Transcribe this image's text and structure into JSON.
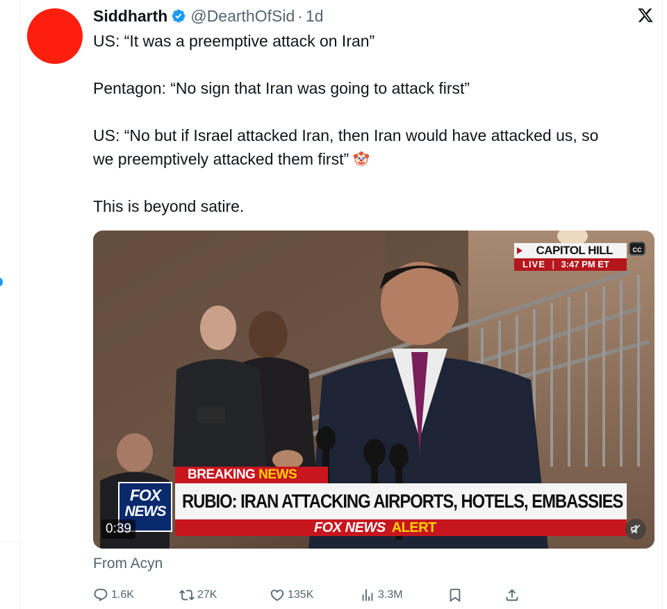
{
  "tweet": {
    "author_name": "Siddharth",
    "handle": "@DearthOfSid",
    "separator": "·",
    "time": "1d",
    "lines": {
      "l1": "US: “It was a preemptive attack on Iran”",
      "l2": "Pentagon: “No sign that Iran was going to attack first”",
      "l3": "US: “No but if Israel attacked Iran, then Iran would have attacked us, so",
      "l4": "we preemptively attacked them first”",
      "l5": "This is beyond satire."
    }
  },
  "video": {
    "location": "CAPITOL HILL",
    "live": "LIVE",
    "live_sep": "|",
    "live_time": "3:47 PM ET",
    "cc": "CC",
    "breaking": "BREAKING",
    "breaking_news": "NEWS",
    "logo_fox": "FOX",
    "logo_news": "NEWS",
    "headline": "RUBIO: IRAN ATTACKING AIRPORTS, HOTELS, EMBASSIES",
    "alert_brand": "FOX NEWS",
    "alert_word": "ALERT",
    "timestamp": "0:39",
    "progress": 0.0
  },
  "source": "From Acyn",
  "actions": {
    "replies": "1.6K",
    "reposts": "27K",
    "likes": "135K",
    "views": "3.3M"
  },
  "colors": {
    "avatar": "#fc1f0e",
    "verified": "#1d9bf0",
    "secondary_text": "#536471",
    "fox_red": "#c8161e",
    "fox_blue": "#0a2a6e",
    "news_yellow": "#ffd200"
  },
  "icons": [
    "verified-badge-icon",
    "x-logo-icon",
    "clown-face-icon",
    "reply-icon",
    "repost-icon",
    "like-icon",
    "views-icon",
    "bookmark-icon",
    "share-icon",
    "mute-icon",
    "closed-captions-icon"
  ]
}
